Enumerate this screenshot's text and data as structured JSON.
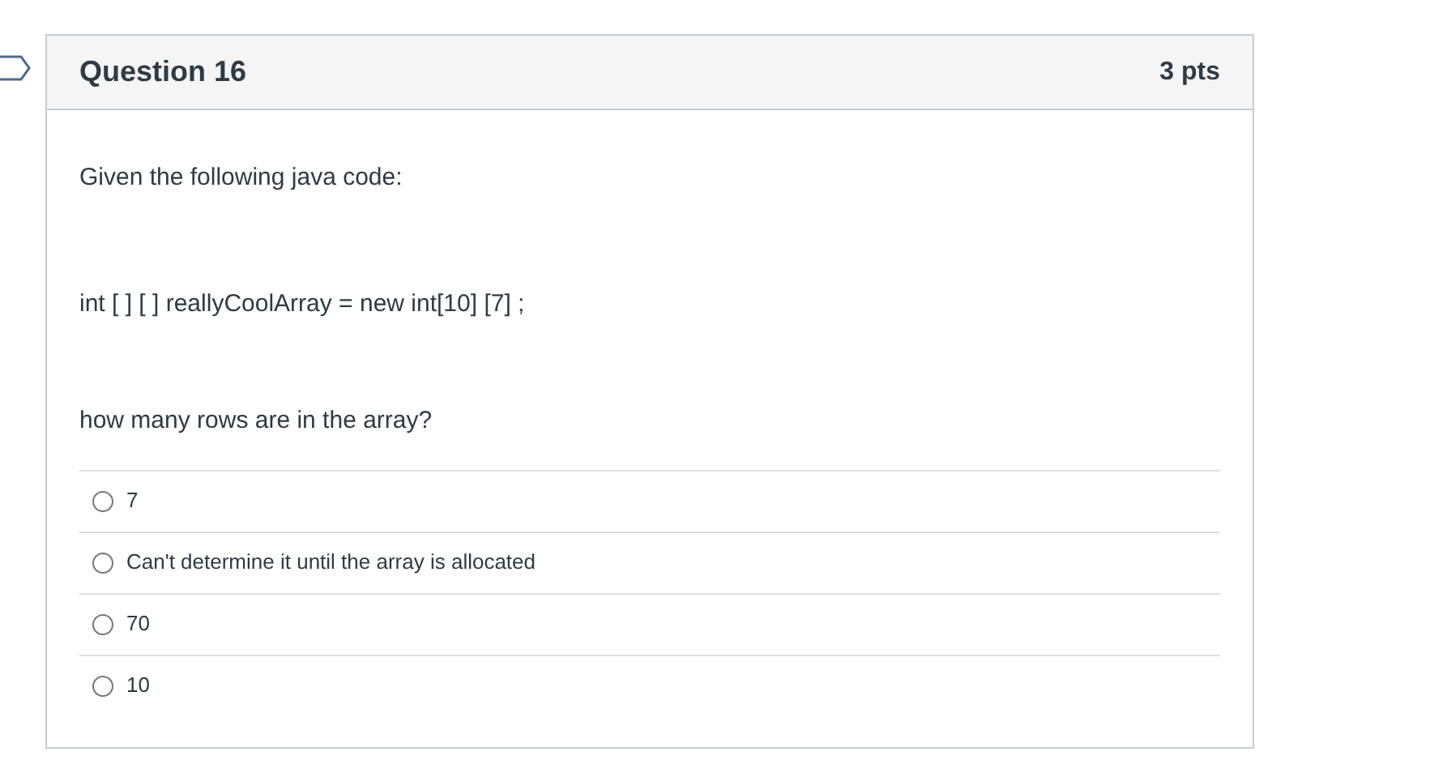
{
  "question": {
    "title": "Question 16",
    "points": "3 pts"
  },
  "paragraphs": [
    "Given the following java code:",
    "int [ ] [ ] reallyCoolArray = new int[10] [7] ;",
    "how many rows are in the array?"
  ],
  "answers": [
    {
      "label": "7",
      "selected": false
    },
    {
      "label": "Can't determine it until the array is allocated",
      "selected": false
    },
    {
      "label": "70",
      "selected": false
    },
    {
      "label": "10",
      "selected": false
    }
  ]
}
